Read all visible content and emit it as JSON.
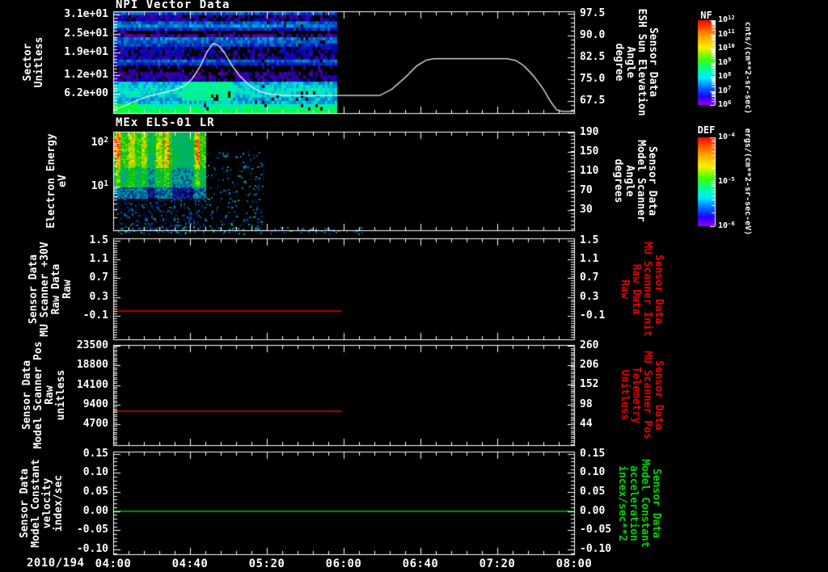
{
  "figure": {
    "background": "#000000",
    "axis_color": "#ffffff",
    "date_label": "2010/194"
  },
  "x_axis": {
    "tick_labels": [
      "04:00",
      "04:40",
      "05:20",
      "06:00",
      "06:40",
      "07:20",
      "08:00"
    ],
    "range_minutes": [
      0,
      240
    ],
    "major_step_min": 40,
    "minor_step_min": 8
  },
  "colorbars": [
    {
      "id": "nf",
      "title": "NF",
      "unit": "cnts/(cm**2-sr-sec)",
      "tick_labels": [
        "10^12",
        "10^11",
        "10^10",
        "10^9",
        "10^8",
        "10^7",
        "10^6"
      ]
    },
    {
      "id": "def",
      "title": "DEF",
      "unit": "ergs/(cm**2-sr-sec-eV)",
      "tick_labels": [
        "10^-4",
        "10^-5",
        "10^-6"
      ]
    }
  ],
  "chart_data": [
    {
      "id": "npi",
      "type": "heatmap+line",
      "title": "NPI Vector Data",
      "left_axis": {
        "label_lines": [
          "Sector",
          "Unitless"
        ],
        "tick_labels": [
          "3.1e+01",
          "2.5e+01",
          "1.9e+01",
          "1.2e+01",
          "6.2e+00"
        ],
        "tick_values": [
          31,
          25,
          19,
          12,
          6.2
        ],
        "min": 0,
        "max": 32,
        "minor": 1
      },
      "right_axis": {
        "label_lines": [
          "Sensor Data",
          "ESH Sun Elevation",
          "Angle",
          "degree"
        ],
        "tick_labels": [
          "97.5",
          "90.0",
          "82.5",
          "75.0",
          "67.5"
        ],
        "tick_values": [
          97.5,
          90,
          82.5,
          75,
          67.5
        ],
        "min": 63.3,
        "max": 98.3,
        "minor": 1.5
      },
      "series": [
        {
          "name": "ESH Sun Elevation Angle",
          "color": "#f2f2f2",
          "axis": "right",
          "points": [
            [
              0,
              64.3
            ],
            [
              6,
              65.8
            ],
            [
              12,
              67.6
            ],
            [
              18,
              69.0
            ],
            [
              26,
              70.3
            ],
            [
              32,
              71.3
            ],
            [
              37,
              72.6
            ],
            [
              41,
              75
            ],
            [
              45,
              79
            ],
            [
              49,
              84.5
            ],
            [
              52,
              87.3
            ],
            [
              55,
              86.5
            ],
            [
              58,
              84
            ],
            [
              62,
              79.5
            ],
            [
              66,
              76
            ],
            [
              71,
              72.8
            ],
            [
              76,
              70.8
            ],
            [
              82,
              69.7
            ],
            [
              90,
              69.4
            ],
            [
              139,
              69.4
            ],
            [
              145,
              71.5
            ],
            [
              152,
              75.5
            ],
            [
              158,
              79.5
            ],
            [
              163,
              81.5
            ],
            [
              167,
              82
            ],
            [
              205,
              82
            ],
            [
              210,
              81.3
            ],
            [
              214,
              79.5
            ],
            [
              219,
              76
            ],
            [
              224,
              71.5
            ],
            [
              228,
              67
            ],
            [
              231,
              64.4
            ],
            [
              234,
              63.9
            ],
            [
              240,
              63.9
            ]
          ]
        }
      ],
      "spectrogram": {
        "colormap": "rainbow",
        "t_start_min": 0,
        "t_end_min": 116.5,
        "rows": 32,
        "row_base_values": [
          0.5,
          0.46,
          0.42,
          0.34,
          0.33,
          0.35,
          0.37,
          0.37,
          0.35,
          0.33,
          0.14,
          0.13,
          0.12,
          0.03,
          0.03,
          0.22,
          0.26,
          0.15,
          0.14,
          0.16,
          0.18,
          0.24,
          0.26,
          0.28,
          0.1,
          0.04,
          0.22,
          0.3,
          0.26,
          0.15,
          0.13,
          0.25
        ],
        "blob": {
          "sector_lo": 4,
          "sector_hi": 9,
          "t_start": 35,
          "t_end": 62,
          "value": 0.43
        },
        "seed": 1234,
        "description": "32 sector rows; blue/cyan horizontal bands, black dropout bands, violet noisy rows, bright cyan-green lowest sectors; data ends near 05:56"
      }
    },
    {
      "id": "els",
      "type": "heatmap",
      "title": "MEx ELS-01 LR",
      "left_axis": {
        "label_lines": [
          "Electron Energy",
          "eV"
        ],
        "tick_labels": [
          "10^2",
          "10^1"
        ],
        "tick_values": [
          100,
          10
        ],
        "min": 1,
        "max": 180,
        "log": true
      },
      "right_axis": {
        "label_lines": [
          "Sensor Data",
          "Model Scanner",
          "Angle",
          "degrees"
        ],
        "tick_labels": [
          "190",
          "150",
          "110",
          "70",
          "30"
        ],
        "tick_values": [
          190,
          150,
          110,
          70,
          30
        ],
        "min": -11.7,
        "max": 191.7,
        "minor": 8
      },
      "series": [],
      "spectrogram": {
        "colormap": "rainbow",
        "t_start_min": 0,
        "t_end_min": 48,
        "e_range_ev": [
          1,
          180
        ],
        "streaks_min": [
          [
            1,
            3,
            0.25
          ],
          [
            8,
            11,
            0.15
          ],
          [
            14,
            17,
            0.12
          ],
          [
            22,
            25,
            0.12
          ],
          [
            26,
            29,
            0.18
          ],
          [
            42,
            45,
            0.22
          ]
        ],
        "gaps_min": [
          [
            18,
            21,
            0.12
          ],
          [
            30,
            41,
            0.12
          ]
        ],
        "speck_t_end": 78,
        "bottom_speck_t_end": 130,
        "seed": 77,
        "description": "Electron energy spectrogram, green/yellow 20-180 eV with bright vertical streaks and red spots, dark blue specks below 10 eV; dense data ends near 04:48"
      }
    },
    {
      "id": "mu-scanner-30v",
      "type": "line",
      "title": "",
      "left_axis": {
        "label_lines": [
          "Sensor Data",
          "MU Scanner +30V",
          "Raw Data",
          "Raw"
        ],
        "tick_labels": [
          "1.5",
          "1.1",
          "0.7",
          "0.3",
          "-0.1"
        ],
        "tick_values": [
          1.5,
          1.1,
          0.7,
          0.3,
          -0.1
        ],
        "min": -0.6,
        "max": 1.55,
        "minor": 0.05
      },
      "right_axis": {
        "label_lines": [
          "Sensor Data",
          "MU Scanner Init",
          "Raw Data",
          "Raw"
        ],
        "tick_labels": [
          "1.5",
          "1.1",
          "0.7",
          "0.3",
          "-0.1"
        ],
        "tick_values": [
          1.5,
          1.1,
          0.7,
          0.3,
          -0.1
        ],
        "min": -0.6,
        "max": 1.55,
        "minor": 0.05,
        "label_color": "#e80000"
      },
      "series": [
        {
          "name": "MU Scanner +30V Raw",
          "color": "#ee0000",
          "axis": "left",
          "points": [
            [
              0,
              0.0
            ],
            [
              119,
              0.0
            ]
          ]
        }
      ]
    },
    {
      "id": "model-scanner-pos",
      "type": "line",
      "title": "",
      "left_axis": {
        "label_lines": [
          "Sensor Data",
          "Model Scanner Pos",
          "Raw",
          "unitless"
        ],
        "tick_labels": [
          "23500",
          "18800",
          "14100",
          "9400",
          "4700"
        ],
        "tick_values": [
          23500,
          18800,
          14100,
          9400,
          4700
        ],
        "min": -340,
        "max": 23700,
        "minor": 470
      },
      "right_axis": {
        "label_lines": [
          "Sensor Data",
          "MU Scanner Pos",
          "Telemetry",
          "Unitless"
        ],
        "tick_labels": [
          "260",
          "206",
          "152",
          "98",
          "44"
        ],
        "tick_values": [
          260,
          206,
          152,
          98,
          44
        ],
        "min": -14,
        "max": 262,
        "minor": 5.4,
        "label_color": "#e80000"
      },
      "series": [
        {
          "name": "Model Scanner Pos Raw",
          "color": "#ee0000",
          "axis": "left",
          "points": [
            [
              0,
              7800
            ],
            [
              119,
              7800
            ]
          ]
        }
      ]
    },
    {
      "id": "model-constant-velocity",
      "type": "line",
      "title": "",
      "left_axis": {
        "label_lines": [
          "Sensor Data",
          "Model Constant",
          "velocity",
          "index/sec"
        ],
        "tick_labels": [
          "0.15",
          "0.10",
          "0.05",
          "0.00",
          "-0.05",
          "-0.10"
        ],
        "tick_values": [
          0.15,
          0.1,
          0.05,
          0.0,
          -0.05,
          -0.1
        ],
        "min": -0.113,
        "max": 0.156,
        "minor": 0.01
      },
      "right_axis": {
        "label_lines": [
          "Sensor Data",
          "Model Constant",
          "acceleration",
          "incex/sec**2"
        ],
        "tick_labels": [
          "0.15",
          "0.10",
          "0.05",
          "0.00",
          "-0.05",
          "-0.10"
        ],
        "tick_values": [
          0.15,
          0.1,
          0.05,
          0.0,
          -0.05,
          -0.1
        ],
        "min": -0.113,
        "max": 0.156,
        "minor": 0.01,
        "label_color": "#00d400"
      },
      "series": [
        {
          "name": "Model Constant velocity",
          "color": "#00c000",
          "axis": "left",
          "points": [
            [
              0,
              0.0
            ],
            [
              240,
              0.0
            ]
          ]
        }
      ]
    }
  ]
}
